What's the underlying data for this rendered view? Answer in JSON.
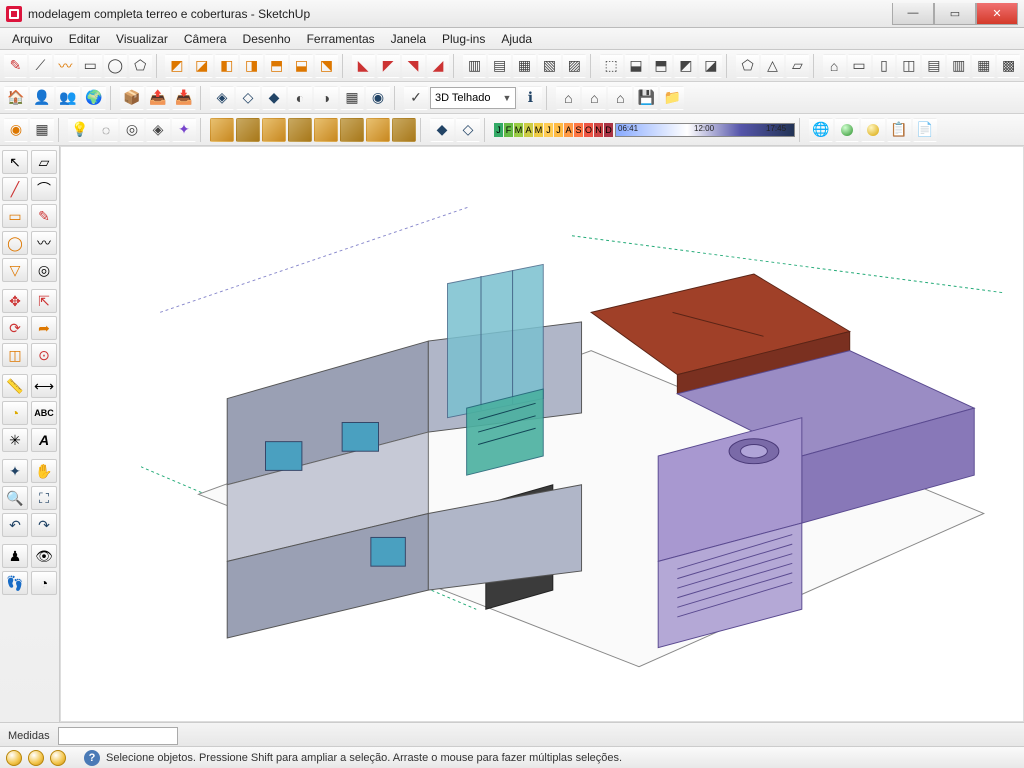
{
  "window": {
    "title": "modelagem completa terreo e coberturas - SketchUp"
  },
  "menu": {
    "items": [
      "Arquivo",
      "Editar",
      "Visualizar",
      "Câmera",
      "Desenho",
      "Ferramentas",
      "Janela",
      "Plug-ins",
      "Ajuda"
    ]
  },
  "toolbar_row1_tooltips": [
    "line",
    "arc",
    "freehand",
    "rectangle",
    "circle",
    "polygon",
    "erase",
    "select",
    "move",
    "rotate",
    "scale",
    "pushpull",
    "followme",
    "offset",
    "tape",
    "protractor",
    "dimension",
    "text",
    "axes",
    "3dtext",
    "section",
    "walls",
    "roof",
    "door",
    "window",
    "stair",
    "component",
    "group",
    "paint",
    "material",
    "sun",
    "shadow",
    "earth",
    "layers",
    "outliner",
    "styles",
    "scenes",
    "animate",
    "walk",
    "export",
    "print"
  ],
  "style_dropdown": {
    "label": "3D Telhado"
  },
  "months_strip": [
    "J",
    "F",
    "M",
    "A",
    "M",
    "J",
    "J",
    "A",
    "S",
    "O",
    "N",
    "D"
  ],
  "time_ticks": {
    "t1": "06:41",
    "t2": "12:00",
    "t3": "17:45"
  },
  "bottom": {
    "measures_label": "Medidas"
  },
  "status": {
    "hint": "Selecione objetos. Pressione Shift para ampliar a seleção. Arraste o mouse para fazer múltiplas seleções."
  }
}
